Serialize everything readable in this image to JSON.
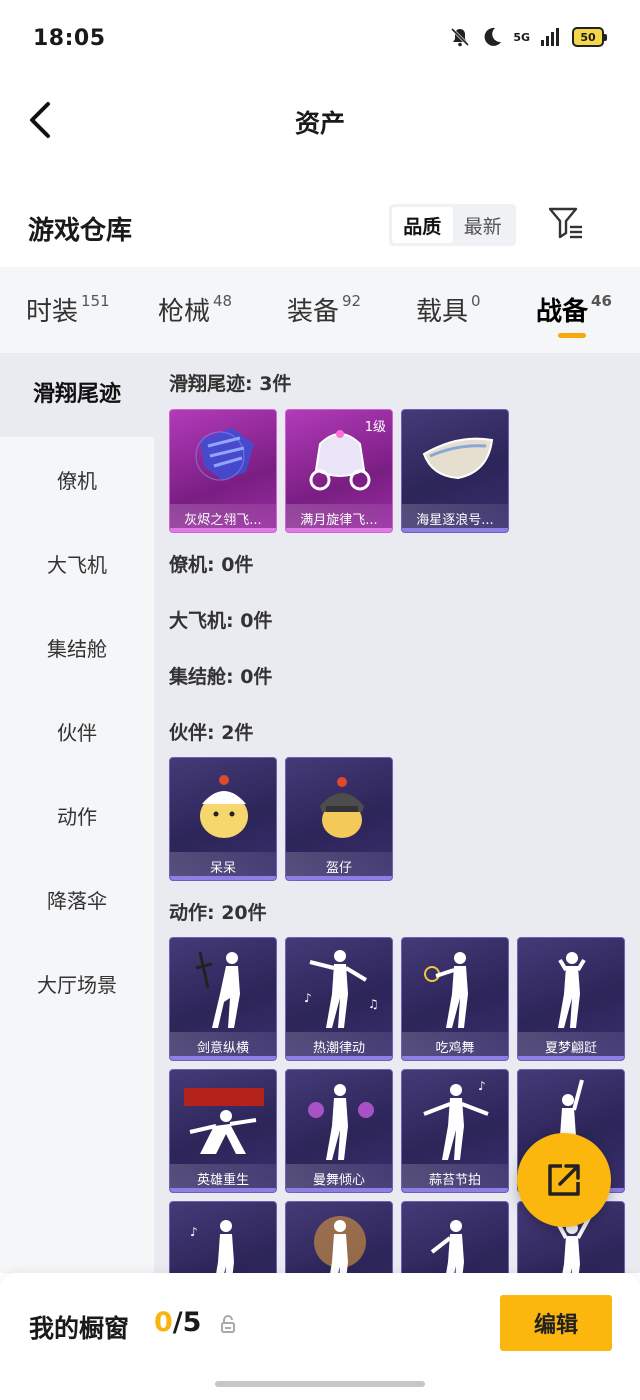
{
  "status_bar": {
    "time": "18:05",
    "network": "5G",
    "battery": "50"
  },
  "header": {
    "title": "资产"
  },
  "warehouse": {
    "title": "游戏仓库",
    "sort_options": [
      "品质",
      "最新"
    ],
    "active_sort": "品质"
  },
  "tabs": [
    {
      "label": "时装",
      "count": "151"
    },
    {
      "label": "枪械",
      "count": "48"
    },
    {
      "label": "装备",
      "count": "92"
    },
    {
      "label": "载具",
      "count": "0"
    },
    {
      "label": "战备",
      "count": "46",
      "active": true
    }
  ],
  "sidebar": {
    "items": [
      {
        "label": "滑翔尾迹",
        "active": true
      },
      {
        "label": "僚机"
      },
      {
        "label": "大飞机"
      },
      {
        "label": "集结舱"
      },
      {
        "label": "伙伴"
      },
      {
        "label": "动作"
      },
      {
        "label": "降落伞"
      },
      {
        "label": "大厅场景"
      }
    ]
  },
  "sections": {
    "glide_trail": {
      "title": "滑翔尾迹: 3件",
      "items": [
        {
          "name": "灰烬之翎飞...",
          "level": ""
        },
        {
          "name": "满月旋律飞...",
          "level": "1级"
        },
        {
          "name": "海星逐浪号..."
        }
      ]
    },
    "wingman": {
      "title": "僚机: 0件"
    },
    "big_plane": {
      "title": "大飞机: 0件"
    },
    "assembly_pod": {
      "title": "集结舱: 0件"
    },
    "partner": {
      "title": "伙伴: 2件",
      "items": [
        {
          "name": "呆呆"
        },
        {
          "name": "盔仔"
        }
      ]
    },
    "emote": {
      "title": "动作: 20件",
      "items": [
        {
          "name": "剑意纵横"
        },
        {
          "name": "热潮律动"
        },
        {
          "name": "吃鸡舞"
        },
        {
          "name": "夏梦翩跹"
        },
        {
          "name": "英雄重生"
        },
        {
          "name": "曼舞倾心"
        },
        {
          "name": "蒜苔节拍"
        }
      ]
    }
  },
  "showcase": {
    "label": "我的橱窗",
    "current": "0",
    "total": "/5",
    "edit_label": "编辑"
  },
  "colors": {
    "accent": "#fbb70d",
    "card_purple": "#2c2558",
    "card_pink": "#9a2da3"
  }
}
